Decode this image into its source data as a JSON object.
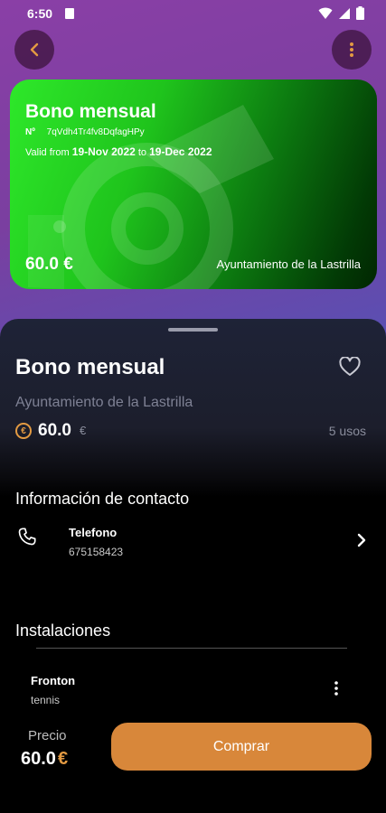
{
  "status_bar": {
    "time": "6:50"
  },
  "card": {
    "title": "Bono mensual",
    "number_label": "Nº",
    "number_value": "7qVdh4Tr4fv8DqfagHPy",
    "valid_prefix": "Valid from",
    "valid_from": "19-Nov 2022",
    "valid_to_word": "to",
    "valid_to": "19-Dec 2022",
    "price": "60.0 €",
    "organization": "Ayuntamiento  de la Lastrilla",
    "colors": {
      "start": "#2ee82a",
      "end": "#012602"
    }
  },
  "detail": {
    "title": "Bono mensual",
    "organization": "Ayuntamiento  de la Lastrilla",
    "coin_symbol": "€",
    "price": "60.0",
    "currency": "€",
    "uses": "5 usos"
  },
  "contact": {
    "heading": "Información de contacto",
    "phone_label": "Telefono",
    "phone_value": "675158423"
  },
  "facilities": {
    "heading": "Instalaciones",
    "items": [
      {
        "name": "Fronton",
        "type": "tennis"
      }
    ]
  },
  "purchase": {
    "price_label": "Precio",
    "price_value": "60.0",
    "currency": "€",
    "button_label": "Comprar",
    "accent": "#d8873a"
  },
  "icons": [
    "back-arrow-icon",
    "more-vert-icon",
    "heart-outline-icon",
    "euro-coin-icon",
    "phone-icon",
    "chevron-right-icon",
    "whistle-watermark"
  ]
}
